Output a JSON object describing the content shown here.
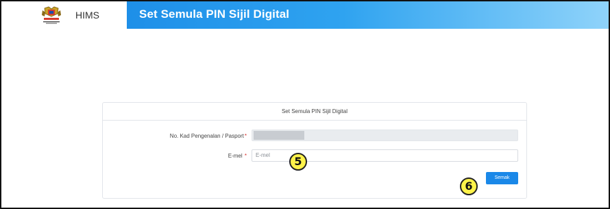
{
  "header": {
    "app_name": "HIMS",
    "page_title": "Set Semula PIN Sijil Digital"
  },
  "form": {
    "card_title": "Set Semula PIN Sijil Digital",
    "id_label": "No. Kad Pengenalan / Pasport",
    "required_mark": "*",
    "id_value": "",
    "email_label": "E-mel",
    "email_placeholder": "E-mel",
    "email_value": "",
    "submit_label": "Semak"
  },
  "annotations": {
    "marker_5": "5",
    "marker_6": "6"
  },
  "colors": {
    "banner_start": "#1e8fe8",
    "banner_end": "#8fd3fa",
    "button": "#1a88e8",
    "required": "#d9302c",
    "marker": "#fff34a"
  }
}
